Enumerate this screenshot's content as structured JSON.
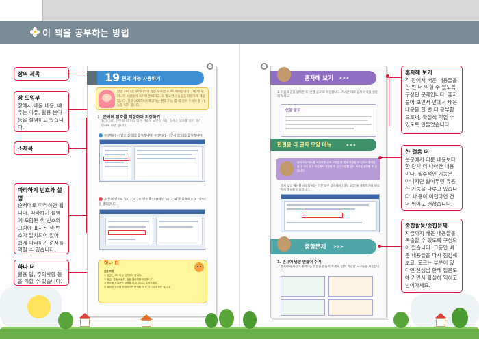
{
  "header": {
    "title": "이 책을 공부하는 방법"
  },
  "left_callouts": [
    {
      "title": "장의 제목",
      "body": ""
    },
    {
      "title": "장 도입부",
      "body": "장에서 배울 내용, 배우는 이유, 활용 분야 등을 설명하고 있습니다."
    },
    {
      "title": "소제목",
      "body": ""
    },
    {
      "title": "따라하기 번호와 설명",
      "body": "순서대로 따라하면 됩니다. 따라하기 설명에 포함된 색 번호와 그림에 표시된 색 번호가 일치되어 있어 쉽게 따라하기 순서를 익힐 수 있습니다."
    },
    {
      "title": "하나 더",
      "body": "활용 팁, 주의사항 등을 익힐 수 있습니다."
    }
  ],
  "right_callouts": [
    {
      "title": "혼자해 보기",
      "body": "각 장에서 배운 내용들을 한 번 더 익힐 수 있도록 구성된 문제입니다. 혼자 풀어 보면서 앞에서 배운 내용을 한 번 더 공부함으로써, 확실히 익힐 수 있도록 만들었습니다."
    },
    {
      "title": "한 걸음 더",
      "body": "본문에서 다룬 내용보다 한 단계 더 나아간 내용이나, 필수적인 기능은 아니지만 알아두면 유용한 기능을 다루고 있습니다. 내용이 어렵다면 건너 뛰어도 괜찮습니다."
    },
    {
      "title": "종합활동/종합문제",
      "body": "지금까지 배운 내용들을 복습할 수 있도록 구성되어 있습니다. 그동안 배운 내용들을 다시 점검해 보고, 모르는 부분이 있다면 선생님 한테 질문도 해 가면서 확실히 익히고 넘어가세요."
    }
  ],
  "left_page": {
    "chapter_number": "19",
    "chapter_title": "편의 기능 사용하기",
    "intro_text": "한글 2007은 우리나라의 많은 우수한 소프트웨어입니다. 그런데 우리나라 사람들이 쓰기에 편리하고, 꼭 필요한 기능들을 다양하게 제공합니다. 한글 2007에서 제공하는 편의 기능 중 꼭 알아 두어야 할 기능을 익혀 봅니다.",
    "subtitle": "1. 문서에 암호를 지정하여 저장하기",
    "subtitle_text": "읽기, 쓰기 권한 등 더 이상 다른 사람이 보면 안 되는 문서는 암호를 걸어 읽기 못하게 하면 됩니다.",
    "step1": "① [파일] – [암호 설정]을 클릭합니다. ② [파일] – [문서 암호]을 클릭합니다.",
    "step2": "③ 문서 암호로 'ss1234', ④ 암호 확인 칸에도 'ss1234'를 입력하고 ⑤ [설정]을 클릭합니다.",
    "tip_tag": "하나 더",
    "tip_lines": [
      "암호 지정",
      "① 암호는 5자 이상 입력해야 합니다.",
      "② 한글, 영문 소문자, 영문 대문자를 구분합니다.",
      "③ 암호를 분실하면 내용을 열 수 없으니 주의하세요.",
      "④ 설정된 암호를 변경하려면 문서를 연 후 다시 설정하면 됩니다."
    ]
  },
  "right_page": {
    "banner1": "혼자해 보기",
    "banner1_arrows": ">>>",
    "q1": "1. 다음의 글을 입력한 후 '산행 공고'로 저장합니다. 지시한 대로 글자 서식을 설정해 보세요.",
    "card_title": "산행 공고",
    "banner2": "한걸음 더 글자 모양 메뉴",
    "banner2_arrows": ">>>",
    "tip_text": "글자 모양 메뉴를 사용하면 글자 모양을 한 번에 변경할 수 있어서 편리합니다. 서식 도구 모음에서 설정할 수 없는 다양한 글자 서식을 설정할 수 있습니다.",
    "step_text": "글자 모양 메뉴를 사용할 때는 기본 도구 상자에서 [글자 모양]을 클릭하거나 바로 가기 메뉴를 이용합니다.",
    "banner3": "종합문제",
    "banner3_arrows": ">>>",
    "q2": "1. 손자에 명함 만들어 주기",
    "q2_text": "손자에게 자신이 좋아하는 명함을 만들어 주세요. 선택 가능한 도구들을 사용합니다."
  },
  "colors": {
    "accent": "#d81b3c",
    "header": "#7a8a95",
    "chapter_blue": "#3d8fd3",
    "purple": "#8f6fc2",
    "teal": "#4fa6a6"
  }
}
